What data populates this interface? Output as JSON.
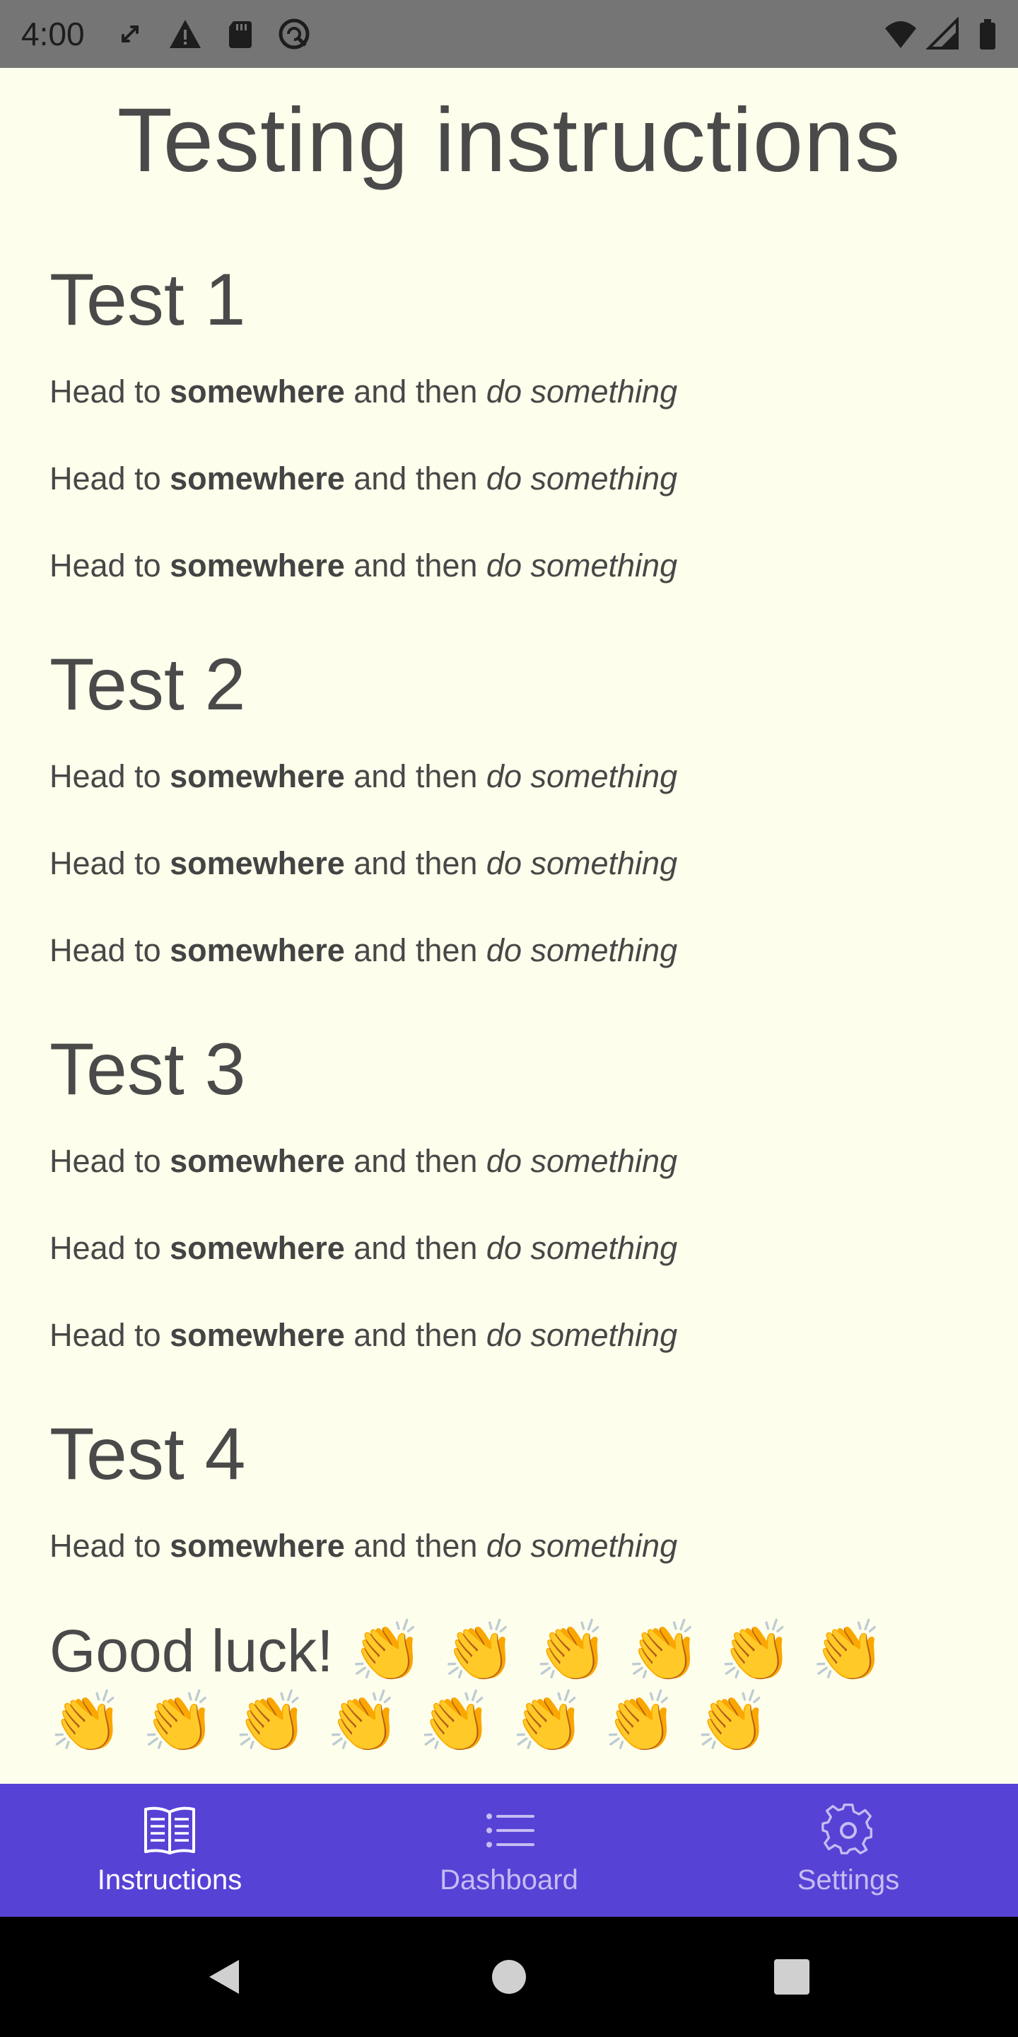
{
  "status_bar": {
    "time": "4:00",
    "icons": [
      "sync-icon",
      "warning-icon",
      "sd-card-icon",
      "data-saver-icon",
      "wifi-icon",
      "signal-icon",
      "battery-icon"
    ]
  },
  "page": {
    "title": "Testing instructions",
    "sections": [
      {
        "title": "Test 1",
        "steps": [
          {
            "prefix": "Head to ",
            "bold": "somewhere",
            "middle": " and then ",
            "italic": "do something"
          },
          {
            "prefix": "Head to ",
            "bold": "somewhere",
            "middle": " and then ",
            "italic": "do something"
          },
          {
            "prefix": "Head to ",
            "bold": "somewhere",
            "middle": " and then ",
            "italic": "do something"
          }
        ]
      },
      {
        "title": "Test 2",
        "steps": [
          {
            "prefix": "Head to ",
            "bold": "somewhere",
            "middle": " and then ",
            "italic": "do something"
          },
          {
            "prefix": "Head to ",
            "bold": "somewhere",
            "middle": " and then ",
            "italic": "do something"
          },
          {
            "prefix": "Head to ",
            "bold": "somewhere",
            "middle": " and then ",
            "italic": "do something"
          }
        ]
      },
      {
        "title": "Test 3",
        "steps": [
          {
            "prefix": "Head to ",
            "bold": "somewhere",
            "middle": " and then ",
            "italic": "do something"
          },
          {
            "prefix": "Head to ",
            "bold": "somewhere",
            "middle": " and then ",
            "italic": "do something"
          },
          {
            "prefix": "Head to ",
            "bold": "somewhere",
            "middle": " and then ",
            "italic": "do something"
          }
        ]
      },
      {
        "title": "Test 4",
        "steps": [
          {
            "prefix": "Head to ",
            "bold": "somewhere",
            "middle": " and then ",
            "italic": "do something"
          }
        ]
      }
    ],
    "closing": {
      "text": "Good luck!",
      "emoji": "👏",
      "emoji_count": 14
    }
  },
  "bottom_nav": {
    "items": [
      {
        "label": "Instructions",
        "icon": "book-icon",
        "active": true
      },
      {
        "label": "Dashboard",
        "icon": "list-icon",
        "active": false
      },
      {
        "label": "Settings",
        "icon": "gear-icon",
        "active": false
      }
    ]
  },
  "system_nav": {
    "buttons": [
      "back-icon",
      "home-icon",
      "recents-icon"
    ]
  },
  "colors": {
    "background": "#fefeec",
    "status_bar": "#757575",
    "bottom_nav": "#5742d6",
    "nav_active": "#ffffff",
    "nav_inactive": "#c5bdf2",
    "text": "#474747"
  }
}
